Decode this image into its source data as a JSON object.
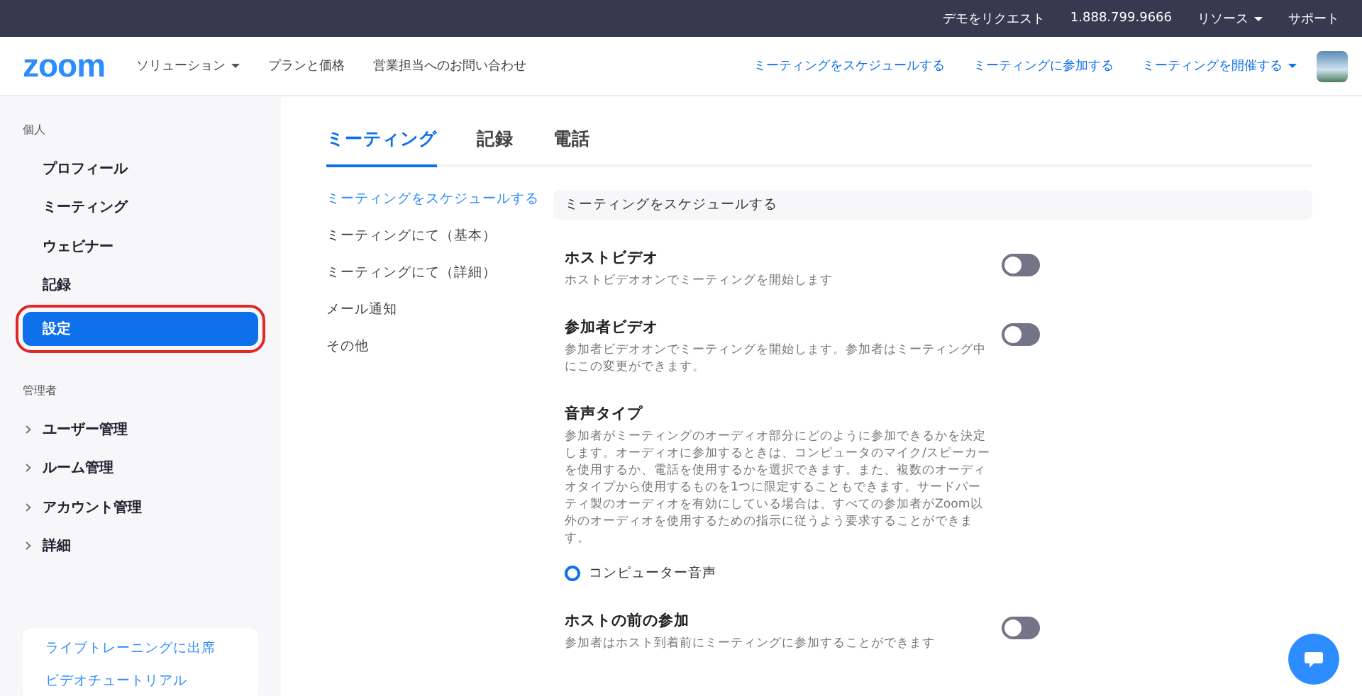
{
  "top_bar": {
    "links": [
      "デモをリクエスト",
      "1.888.799.9666",
      "リソース",
      "サポート"
    ]
  },
  "nav": {
    "logo": "zoom",
    "left_links": [
      {
        "label": "ソリューション",
        "dropdown": true
      },
      {
        "label": "プランと価格",
        "dropdown": false
      },
      {
        "label": "営業担当へのお問い合わせ",
        "dropdown": false
      }
    ],
    "right_links": [
      {
        "label": "ミーティングをスケジュールする",
        "dropdown": false
      },
      {
        "label": "ミーティングに参加する",
        "dropdown": false
      },
      {
        "label": "ミーティングを開催する",
        "dropdown": true
      }
    ]
  },
  "sidebar": {
    "sections": [
      {
        "title": "個人",
        "items": [
          {
            "label": "プロフィール",
            "selected": false,
            "expandable": false
          },
          {
            "label": "ミーティング",
            "selected": false,
            "expandable": false
          },
          {
            "label": "ウェビナー",
            "selected": false,
            "expandable": false
          },
          {
            "label": "記録",
            "selected": false,
            "expandable": false
          },
          {
            "label": "設定",
            "selected": true,
            "expandable": false
          }
        ]
      },
      {
        "title": "管理者",
        "items": [
          {
            "label": "ユーザー管理",
            "selected": false,
            "expandable": true
          },
          {
            "label": "ルーム管理",
            "selected": false,
            "expandable": true
          },
          {
            "label": "アカウント管理",
            "selected": false,
            "expandable": true
          },
          {
            "label": "詳細",
            "selected": false,
            "expandable": true
          }
        ]
      }
    ],
    "help_links": [
      "ライブトレーニングに出席",
      "ビデオチュートリアル"
    ]
  },
  "tabs": [
    {
      "label": "ミーティング",
      "selected": true
    },
    {
      "label": "記録",
      "selected": false
    },
    {
      "label": "電話",
      "selected": false
    }
  ],
  "submenu": [
    {
      "label": "ミーティングをスケジュールする",
      "selected": true
    },
    {
      "label": "ミーティングにて（基本）",
      "selected": false
    },
    {
      "label": "ミーティングにて（詳細）",
      "selected": false
    },
    {
      "label": "メール通知",
      "selected": false
    },
    {
      "label": "その他",
      "selected": false
    }
  ],
  "section_title": "ミーティングをスケジュールする",
  "settings": [
    {
      "kind": "toggle",
      "title": "ホストビデオ",
      "description": "ホストビデオオンでミーティングを開始します",
      "on": false
    },
    {
      "kind": "toggle",
      "title": "参加者ビデオ",
      "description": "参加者ビデオオンでミーティングを開始します。参加者はミーティング中にこの変更ができます。",
      "on": false
    },
    {
      "kind": "radio",
      "title": "音声タイプ",
      "description": "参加者がミーティングのオーディオ部分にどのように参加できるかを決定します。オーディオに参加するときは、コンピュータのマイク/スピーカーを使用するか、電話を使用するかを選択できます。また、複数のオーディオタイプから使用するものを1つに限定することもできます。サードパーティ製のオーディオを有効にしている場合は、すべての参加者がZoom以外のオーディオを使用するための指示に従うよう要求することができます。",
      "options": [
        {
          "label": "コンピューター音声",
          "selected": true
        }
      ]
    },
    {
      "kind": "toggle",
      "title": "ホストの前の参加",
      "description": "参加者はホスト到着前にミーティングに参加することができます",
      "on": false
    }
  ]
}
